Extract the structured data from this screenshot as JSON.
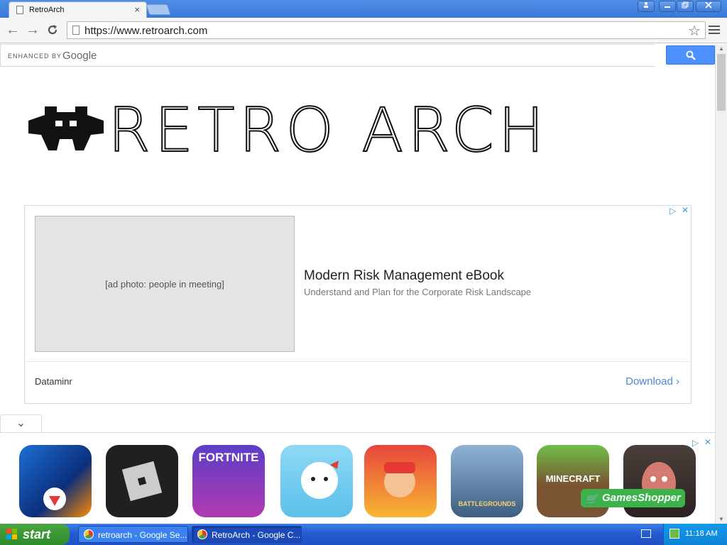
{
  "browser": {
    "tab_title": "RetroArch",
    "url": "https://www.retroarch.com",
    "window_buttons": [
      "user",
      "minimize",
      "restore",
      "close"
    ]
  },
  "search": {
    "enhanced_by": "ENHANCED BY",
    "google": "Google"
  },
  "logo": {
    "text": "RETRO ARCH"
  },
  "ad": {
    "headline": "Modern Risk Management eBook",
    "description": "Understand and Plan for the Corporate Risk Landscape",
    "advertiser": "Dataminr",
    "cta": "Download",
    "cta_arrow": "›"
  },
  "apps": [
    {
      "name": "Free Fire",
      "label": ""
    },
    {
      "name": "Roblox",
      "label": ""
    },
    {
      "name": "Fortnite",
      "label": "FORTNITE"
    },
    {
      "name": "Toca Boca",
      "label": ""
    },
    {
      "name": "Subway Surfers",
      "label": ""
    },
    {
      "name": "PUBG",
      "label": "BATTLEGROUNDS"
    },
    {
      "name": "Minecraft",
      "label": "MINECRAFT"
    },
    {
      "name": "Scary Teacher",
      "label": ""
    }
  ],
  "games_shopper": "GamesShopper",
  "taskbar": {
    "start": "start",
    "items": [
      {
        "label": "retroarch - Google Se...",
        "active": false
      },
      {
        "label": "RetroArch - Google C...",
        "active": true
      }
    ],
    "clock": "11:18 AM"
  },
  "colors": {
    "accent": "#4d90fe",
    "link": "#4a8ad2",
    "xp_taskbar": "#2458cf"
  }
}
